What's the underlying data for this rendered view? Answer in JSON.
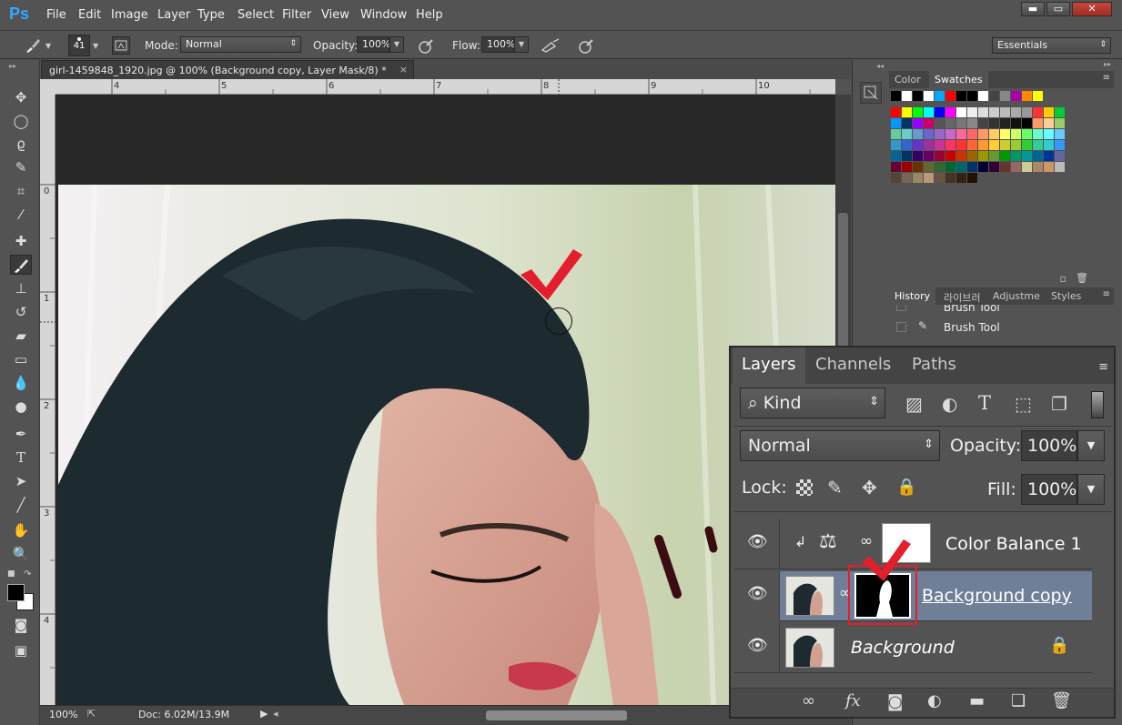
{
  "app": {
    "logo": "Ps"
  },
  "menu": [
    "File",
    "Edit",
    "Image",
    "Layer",
    "Type",
    "Select",
    "Filter",
    "View",
    "Window",
    "Help"
  ],
  "window_controls": {
    "minimize": "▬",
    "maximize": "▭",
    "close": "✕"
  },
  "options": {
    "brush_size": "41",
    "mode_label": "Mode:",
    "mode_value": "Normal",
    "opacity_label": "Opacity:",
    "opacity_value": "100%",
    "flow_label": "Flow:",
    "flow_value": "100%",
    "workspace": "Essentials"
  },
  "document": {
    "tab_title": "girl-1459848_1920.jpg @ 100% (Background copy, Layer Mask/8) *",
    "close": "×",
    "ruler_h": [
      "4",
      "5",
      "6",
      "7",
      "8",
      "9",
      "10"
    ],
    "ruler_v": [
      "0",
      "1",
      "2",
      "3",
      "4"
    ]
  },
  "status": {
    "zoom": "100%",
    "doc": "Doc: 6.02M/13.9M"
  },
  "swatch_panel": {
    "tabs": [
      "Color",
      "Swatches"
    ]
  },
  "history_panel": {
    "tabs": [
      "History",
      "라이브러",
      "Adjustme",
      "Styles"
    ],
    "items": [
      "Brush Tool",
      "Brush Tool"
    ]
  },
  "layers_panel": {
    "tabs": [
      "Layers",
      "Channels",
      "Paths"
    ],
    "filter_kind": "Kind",
    "blend_mode": "Normal",
    "opacity_label": "Opacity:",
    "opacity_value": "100%",
    "lock_label": "Lock:",
    "fill_label": "Fill:",
    "fill_value": "100%",
    "layers": [
      {
        "name": "Color Balance 1",
        "type": "adjustment"
      },
      {
        "name": "Background copy",
        "type": "masked",
        "selected": true
      },
      {
        "name": "Background",
        "type": "base",
        "locked": true
      }
    ]
  },
  "colors": {
    "accent": "#31a8ff",
    "selected_layer": "#6f7f97",
    "annotation_check": "#e51e2b"
  },
  "icons": [
    "brush-icon",
    "eye-icon",
    "lock-icon",
    "link-icon",
    "trash-icon",
    "folder-icon",
    "new-layer-icon",
    "fx-icon",
    "mask-icon",
    "adjustment-icon",
    "move-tool-icon",
    "marquee-icon",
    "lasso-icon",
    "crop-icon",
    "eyedropper-icon",
    "healing-icon",
    "stamp-icon",
    "eraser-icon",
    "gradient-icon",
    "blur-icon",
    "dodge-icon",
    "pen-icon",
    "type-icon",
    "path-select-icon",
    "line-icon",
    "hand-icon",
    "zoom-icon"
  ]
}
